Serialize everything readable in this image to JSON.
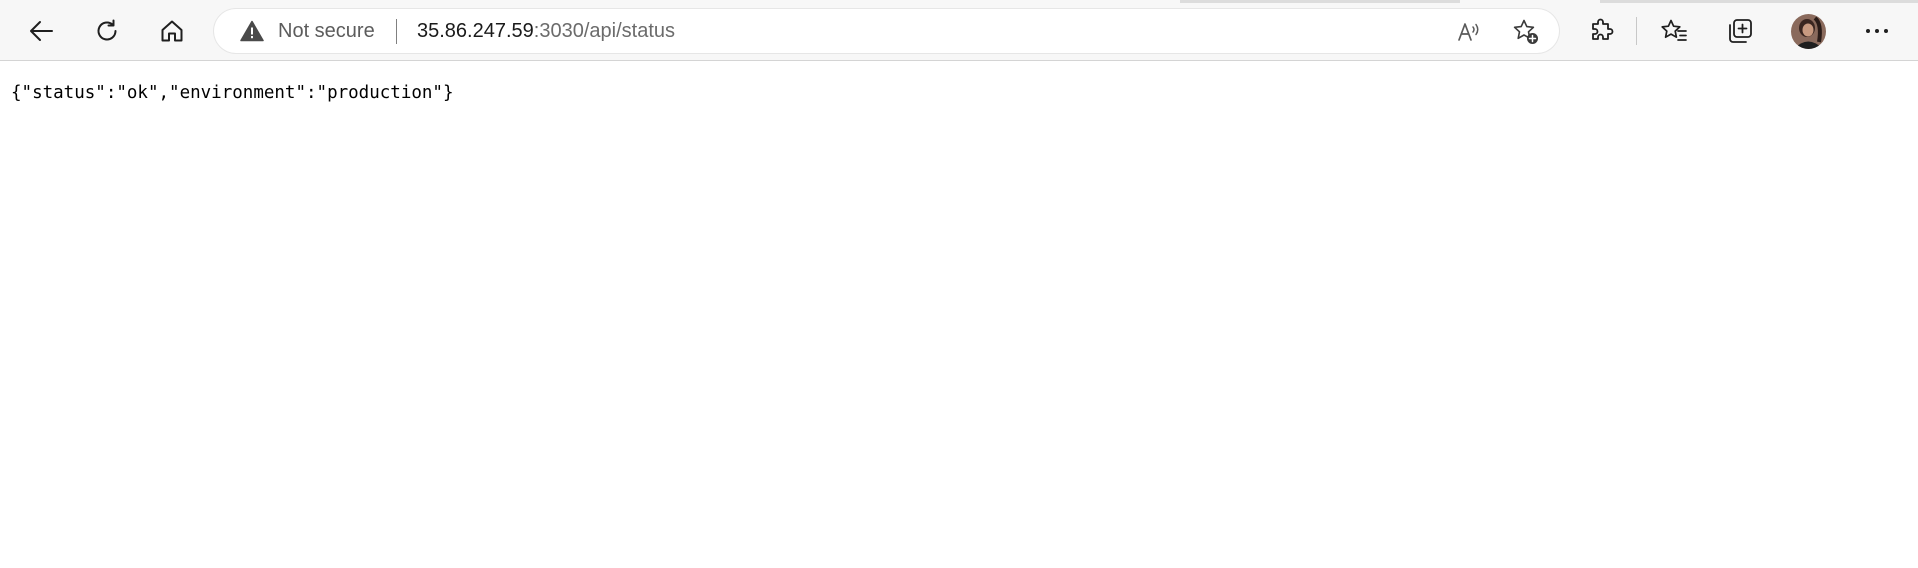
{
  "toolbar": {
    "back_icon": "back-arrow-icon",
    "refresh_icon": "refresh-icon",
    "home_icon": "home-icon"
  },
  "address_bar": {
    "security_icon": "warning-triangle-icon",
    "security_label": "Not secure",
    "url_host": "35.86.247.59",
    "url_rest": ":3030/api/status",
    "read_aloud_icon": "read-aloud-icon",
    "add_favorite_icon": "add-favorite-icon"
  },
  "browser_actions": {
    "extensions_icon": "puzzle-piece-icon",
    "favorites_icon": "favorites-list-icon",
    "collections_icon": "collections-icon",
    "profile_icon": "profile-avatar",
    "menu_icon": "more-dots-icon"
  },
  "page": {
    "body_text": "{\"status\":\"ok\",\"environment\":\"production\"}"
  },
  "colors": {
    "toolbar_bg": "#f7f7f7",
    "page_bg": "#ffffff",
    "icon": "#1f1f1f",
    "url_dim": "#6b6b6b"
  }
}
